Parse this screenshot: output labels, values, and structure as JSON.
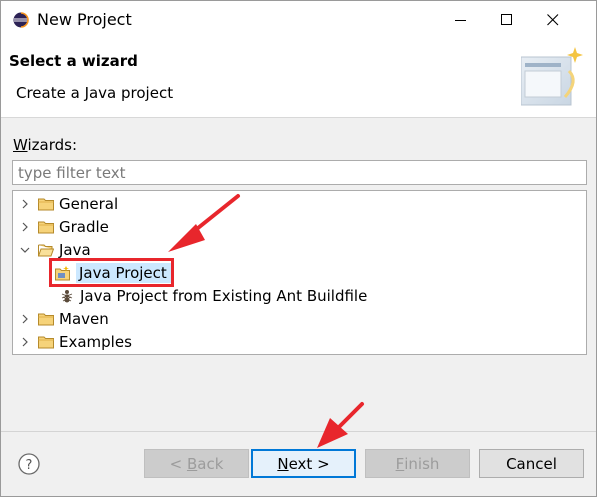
{
  "window": {
    "title": "New Project"
  },
  "banner": {
    "title": "Select a wizard",
    "description": "Create a Java project"
  },
  "wizards": {
    "label_prefix": "W",
    "label_rest": "izards:",
    "filter_placeholder": "type filter text"
  },
  "tree": {
    "items": [
      {
        "label": "General",
        "expanded": false,
        "level": 0,
        "icon": "folder-icon"
      },
      {
        "label": "Gradle",
        "expanded": false,
        "level": 0,
        "icon": "folder-icon"
      },
      {
        "label": "Java",
        "expanded": true,
        "level": 0,
        "icon": "folder-icon"
      },
      {
        "label": "Java Project",
        "level": 1,
        "icon": "java-project-icon",
        "selected": true
      },
      {
        "label": "Java Project from Existing Ant Buildfile",
        "level": 1,
        "icon": "ant-icon"
      },
      {
        "label": "Maven",
        "expanded": false,
        "level": 0,
        "icon": "folder-icon"
      },
      {
        "label": "Examples",
        "expanded": false,
        "level": 0,
        "icon": "folder-icon"
      }
    ]
  },
  "buttons": {
    "back_prefix": "< ",
    "back_mnemonic": "B",
    "back_rest": "ack",
    "next_mnemonic": "N",
    "next_rest": "ext >",
    "finish_mnemonic": "F",
    "finish_rest": "inish",
    "cancel": "Cancel"
  },
  "colors": {
    "selection": "#cce8ff",
    "annotation": "#e8262c",
    "default_button_border": "#0078d7"
  }
}
